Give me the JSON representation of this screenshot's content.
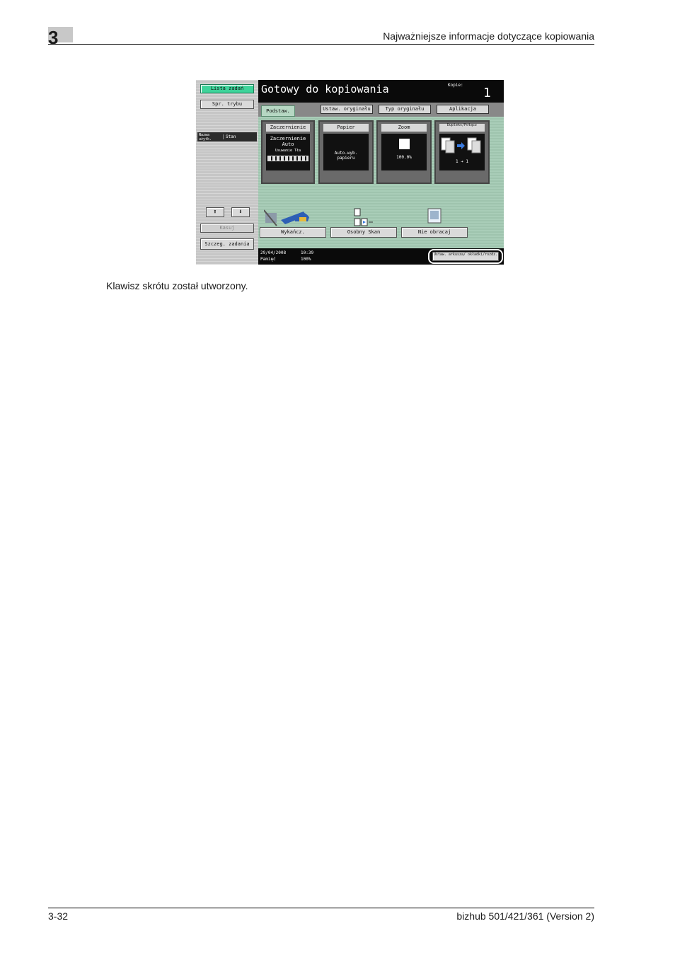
{
  "header": {
    "chapter_number": "3",
    "title": "Najważniejsze informacje dotyczące kopiowania"
  },
  "caption": "Klawisz skrótu został utworzony.",
  "footer": {
    "page": "3-32",
    "product": "bizhub 501/421/361 (Version 2)"
  },
  "screen": {
    "left_panel": {
      "job_list_button": "Lista zadań",
      "check_mode_button": "Spr. trybu",
      "col_user": "Nazwa użytk.",
      "col_status": "Stan",
      "delete_button": "Kasuj",
      "job_details_button": "Szczeg. zadania"
    },
    "title": "Gotowy do kopiowania",
    "copies_label": "Kopie:",
    "copies_value": "1",
    "tabs": [
      "Podstaw.",
      "Ustaw. oryginału",
      "Typ oryginału",
      "Aplikacja"
    ],
    "tiles": {
      "density": {
        "label": "Zaczernienie",
        "value": "Zaczernienie Auto",
        "sub": "Usuwanie Tła"
      },
      "paper": {
        "label": "Papier",
        "value": "Auto.wyb. papieru"
      },
      "zoom": {
        "label": "Zoom",
        "value": "100.0%"
      },
      "duplex": {
        "label": "Dupleks/Połącz",
        "value": "1 ➔ 1"
      }
    },
    "bottom_buttons": {
      "finishing": "Wykańcz.",
      "separate_scan": "Osobny Skan",
      "no_rotate": "Nie obracaj"
    },
    "status": {
      "date": "29/04/2008",
      "time": "10:39",
      "memory_label": "Pamięć",
      "memory_value": "100%"
    },
    "shortcut_button": "Ustaw. arkusza/ okładki/rozdz."
  }
}
